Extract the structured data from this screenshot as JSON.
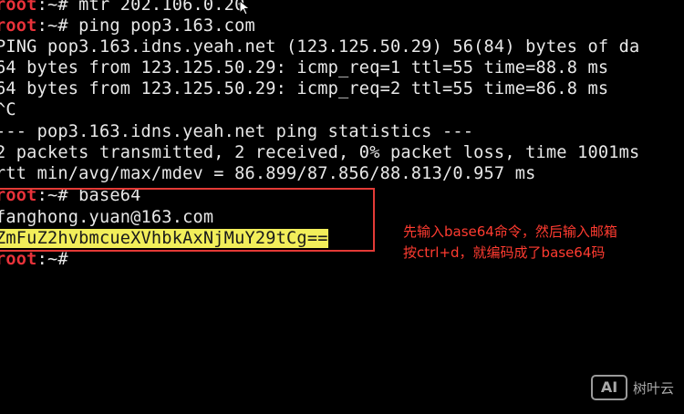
{
  "terminal": {
    "lines": [
      {
        "user": "root",
        "sep": ":~#",
        "text": " mtr 202.106.0.20"
      },
      {
        "user": "root",
        "sep": ":~#",
        "text": " ping pop3.163.com"
      },
      {
        "text": "PING pop3.163.idns.yeah.net (123.125.50.29) 56(84) bytes of da"
      },
      {
        "text": "64 bytes from 123.125.50.29: icmp_req=1 ttl=55 time=88.8 ms"
      },
      {
        "text": "64 bytes from 123.125.50.29: icmp_req=2 ttl=55 time=86.8 ms"
      },
      {
        "text": "^C"
      },
      {
        "text": "--- pop3.163.idns.yeah.net ping statistics ---"
      },
      {
        "text": "2 packets transmitted, 2 received, 0% packet loss, time 1001ms"
      },
      {
        "text": "rtt min/avg/max/mdev = 86.899/87.856/88.813/0.957 ms"
      },
      {
        "user": "root",
        "sep": ":~#",
        "text": " base64"
      },
      {
        "text": "fanghong.yuan@163.com"
      },
      {
        "highlight": "ZmFuZ2hvbmcueXVhbkAxNjMuY29tCg=="
      },
      {
        "user": "root",
        "sep": ":~#",
        "text": ""
      }
    ]
  },
  "annotation": {
    "line1": "先输入base64命令，然后输入邮箱",
    "line2": "按ctrl+d，就编码成了base64码"
  },
  "watermark": {
    "logo": "AI",
    "text": "树叶云"
  },
  "colors": {
    "background": "#000000",
    "prompt": "#e8323a",
    "text": "#e8e8e8",
    "highlight": "#f2ee5a",
    "box": "#e33a36",
    "annotation": "#ff3b30"
  }
}
